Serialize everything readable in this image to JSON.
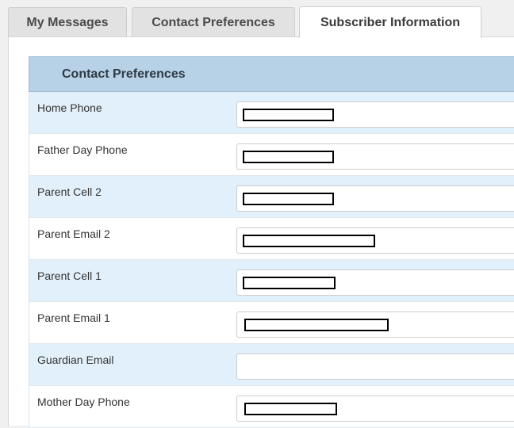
{
  "tabs": [
    {
      "label": "My Messages",
      "active": false
    },
    {
      "label": "Contact Preferences",
      "active": false
    },
    {
      "label": "Subscriber Information",
      "active": true
    }
  ],
  "form": {
    "header": "Contact Preferences",
    "rows": [
      {
        "label": "Home Phone",
        "value_redacted": true
      },
      {
        "label": "Father Day Phone",
        "value_redacted": true
      },
      {
        "label": "Parent Cell 2",
        "value_redacted": true
      },
      {
        "label": "Parent Email 2",
        "value_redacted": true
      },
      {
        "label": "Parent Cell 1",
        "value_redacted": true
      },
      {
        "label": "Parent Email 1",
        "value_redacted": true
      },
      {
        "label": "Guardian Email",
        "value_redacted": false
      },
      {
        "label": "Mother Day Phone",
        "value_redacted": true
      }
    ]
  },
  "colors": {
    "header_bg": "#b7d1e6",
    "row_shaded_bg": "#e2f0fb",
    "tab_bg": "#e2e2e2",
    "active_tab_bg": "#ffffff"
  }
}
